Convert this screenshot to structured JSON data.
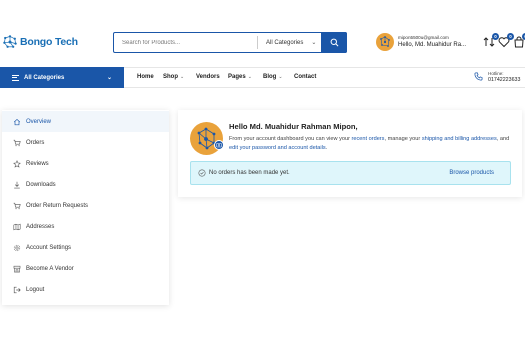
{
  "brand": {
    "name": "Bongo Tech",
    "accent": "#1a56a8"
  },
  "search": {
    "placeholder": "Search for Products...",
    "category": "All Categories"
  },
  "user": {
    "email": "mipon5500u@gmail.com",
    "greeting": "Hello, Md. Muahidur Ra..."
  },
  "header_icons": {
    "compare_count": "0",
    "wishlist_count": "0",
    "cart_count": "0"
  },
  "nav": {
    "all_categories": "All Categories",
    "items": [
      "Home",
      "Shop",
      "Vendors",
      "Pages",
      "Blog",
      "Contact"
    ],
    "hotline_label": "Hotline:",
    "hotline_number": "01742223633"
  },
  "sidebar": {
    "items": [
      {
        "label": "Overview",
        "icon": "home-icon"
      },
      {
        "label": "Orders",
        "icon": "cart-icon"
      },
      {
        "label": "Reviews",
        "icon": "star-icon"
      },
      {
        "label": "Downloads",
        "icon": "download-icon"
      },
      {
        "label": "Order Return Requests",
        "icon": "cart-return-icon"
      },
      {
        "label": "Addresses",
        "icon": "map-icon"
      },
      {
        "label": "Account Settings",
        "icon": "gear-icon"
      },
      {
        "label": "Become A Vendor",
        "icon": "store-icon"
      },
      {
        "label": "Logout",
        "icon": "logout-icon"
      }
    ]
  },
  "dashboard": {
    "title": "Hello Md. Muahidur Rahman Mipon,",
    "intro_1": "From your account dashboard you can view your ",
    "link_orders": "recent orders",
    "intro_2": ", manage your ",
    "link_addresses": "shipping and billing addresses",
    "intro_3": ", and ",
    "link_account": "edit your password and account details",
    "intro_4": ".",
    "notice": "No orders has been made yet.",
    "browse": "Browse products"
  }
}
